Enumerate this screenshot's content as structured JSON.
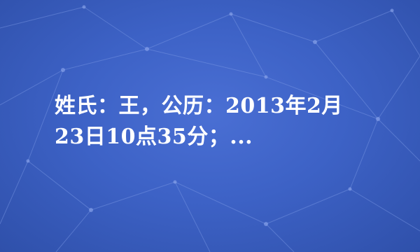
{
  "title": {
    "line1": "姓氏：王，公历：2013年2月",
    "line2": "23日10点35分；..."
  },
  "colors": {
    "background": "#3b5ec2",
    "text": "#ffffff",
    "network_lines": "#6f8fe0"
  }
}
